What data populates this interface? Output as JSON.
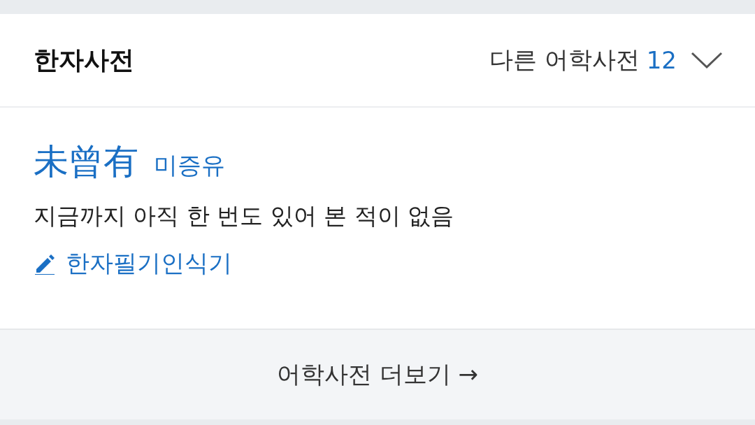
{
  "header": {
    "title": "한자사전",
    "other_label": "다른 어학사전",
    "other_count": "12",
    "expanded": false
  },
  "entry": {
    "hanja": "未曾有",
    "reading": "미증유",
    "meaning": "지금까지 아직 한 번도 있어 본 적이 없음"
  },
  "handwriting_link": "한자필기인식기",
  "more_button": {
    "label": "어학사전 더보기",
    "arrow": "→"
  }
}
